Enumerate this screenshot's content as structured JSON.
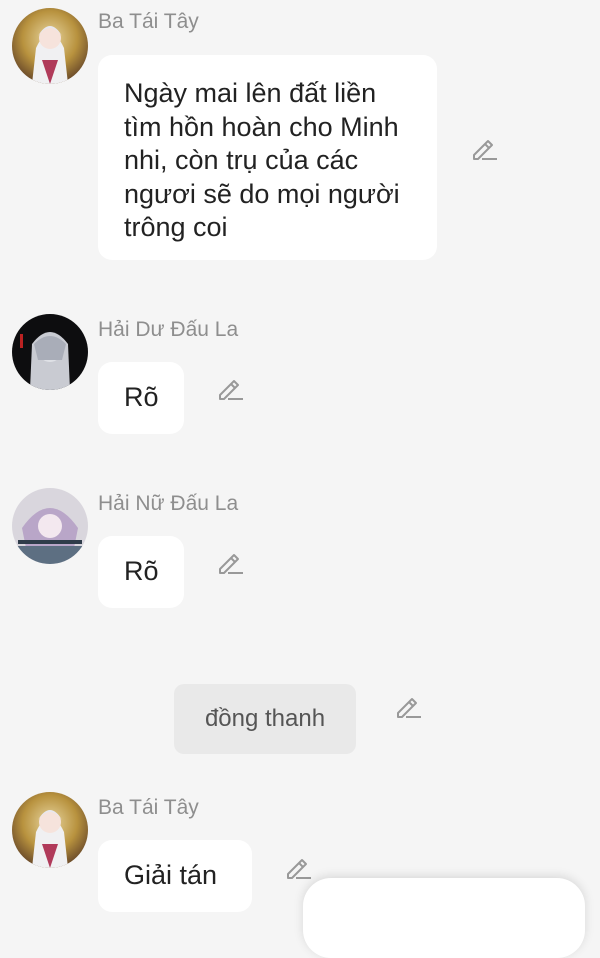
{
  "messages": [
    {
      "sender": "Ba Tái Tây",
      "avatar_icon": "character-avatar-icon",
      "lines": [
        "Ngày mai lên đất liền",
        "tìm hồn hoàn cho Minh",
        "nhi, còn trụ của các",
        "ngươi sẽ do mọi người",
        "trông coi"
      ]
    },
    {
      "sender": "Hải Dư Đấu La",
      "avatar_icon": "character-avatar-icon",
      "text": "Rõ"
    },
    {
      "sender": "Hải Nữ Đấu La",
      "avatar_icon": "character-avatar-icon",
      "text": "Rõ"
    },
    {
      "sender": "Ba Tái Tây",
      "avatar_icon": "character-avatar-icon",
      "text": "Giải tán"
    }
  ],
  "narration": {
    "text": "đồng thanh"
  },
  "icons": {
    "edit": "pencil-edit-icon"
  },
  "colors": {
    "background": "#f5f5f5",
    "bubble": "#ffffff",
    "narration_bg": "#e9e9e9",
    "sender_text": "#8e8e8e",
    "message_text": "#222222",
    "icon": "#999999"
  }
}
